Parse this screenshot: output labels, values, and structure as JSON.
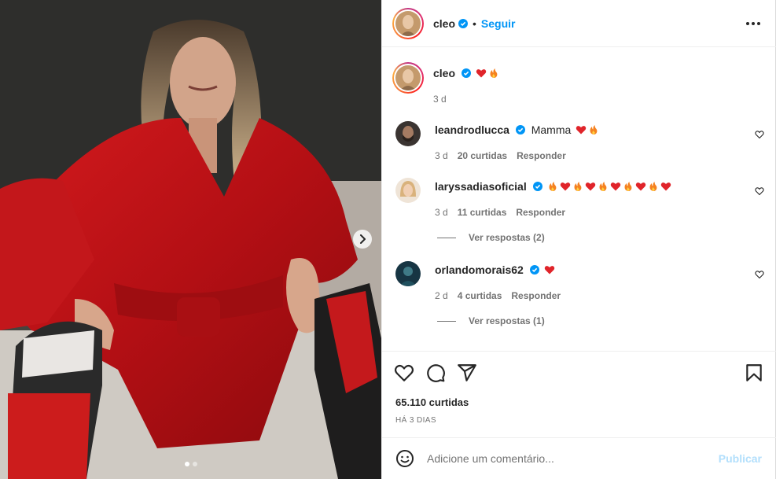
{
  "post": {
    "author": "cleo",
    "follow_label": "Seguir",
    "separator": "•",
    "more_icon": "more-horizontal-icon"
  },
  "caption": {
    "username": "cleo",
    "emojis": [
      "red-heart",
      "fire"
    ],
    "time": "3 d"
  },
  "comments": [
    {
      "username": "leandrodlucca",
      "text": "Mamma",
      "emojis": [
        "red-heart",
        "fire"
      ],
      "time": "3 d",
      "likes": "20 curtidas",
      "reply_label": "Responder"
    },
    {
      "username": "laryssadiasoficial",
      "text": "",
      "emojis": [
        "fire",
        "red-heart",
        "fire",
        "red-heart",
        "fire",
        "red-heart",
        "fire",
        "red-heart",
        "fire",
        "red-heart"
      ],
      "time": "3 d",
      "likes": "11 curtidas",
      "reply_label": "Responder",
      "view_replies": "Ver respostas (2)"
    },
    {
      "username": "orlandomorais62",
      "text": "",
      "emojis": [
        "red-heart"
      ],
      "time": "2 d",
      "likes": "4 curtidas",
      "reply_label": "Responder",
      "view_replies": "Ver respostas (1)"
    }
  ],
  "actions": {
    "icons": [
      "heart-icon",
      "comment-icon",
      "share-icon",
      "bookmark-icon"
    ],
    "likes_count": "65.110 curtidas",
    "date": "HÁ 3 DIAS"
  },
  "composer": {
    "placeholder": "Adicione um comentário...",
    "publish_label": "Publicar",
    "emoji_icon": "smiley-icon"
  },
  "carousel": {
    "slide_count": 2,
    "current_slide": 1
  },
  "colors": {
    "accent": "#0095f6",
    "publish_disabled": "#b2dffc",
    "verified": "#0095f6",
    "secondary_text": "#737373"
  }
}
